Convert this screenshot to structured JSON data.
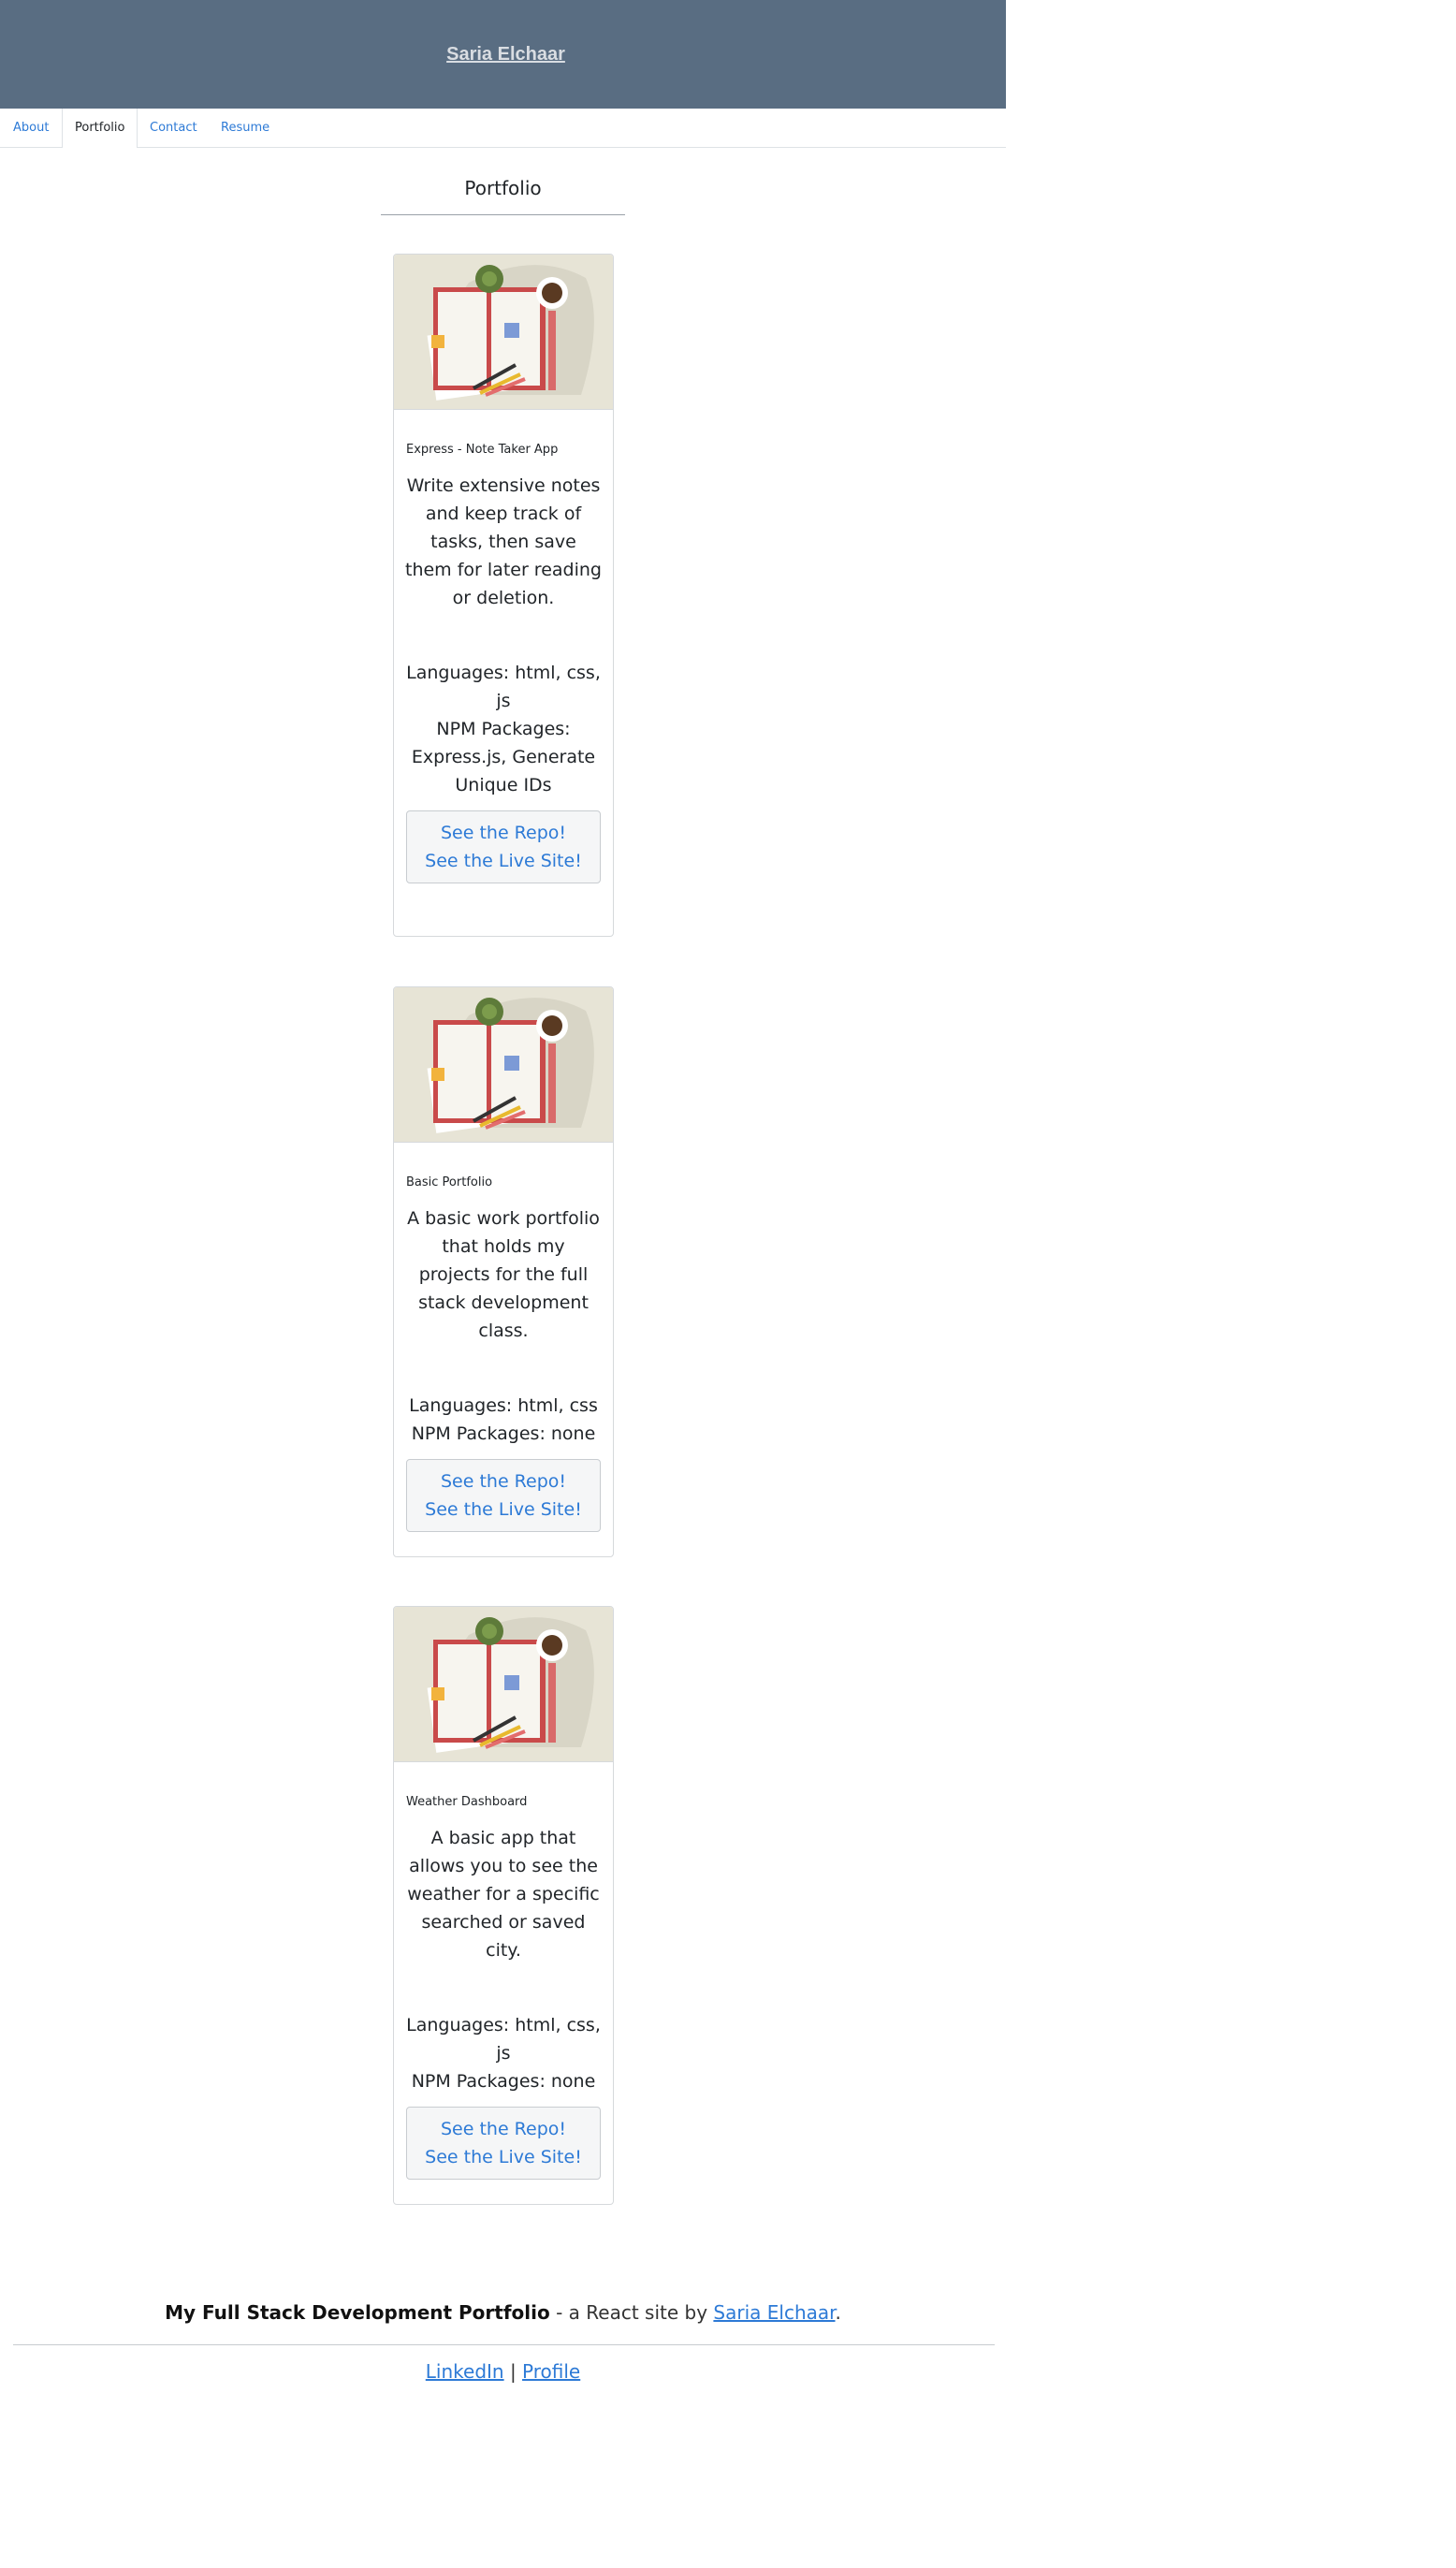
{
  "header": {
    "title": "Saria Elchaar"
  },
  "nav": {
    "items": [
      "About",
      "Portfolio",
      "Contact",
      "Resume"
    ]
  },
  "main": {
    "title": "Portfolio",
    "projects": [
      {
        "name": "Express - Note Taker App",
        "description": "Write extensive notes and keep track of tasks, then save them for later reading or deletion.",
        "languages": "Languages: html, css, js",
        "packages": "NPM Packages: Express.js, Generate Unique IDs",
        "repo_label": "See the Repo!",
        "live_label": "See the Live Site!"
      },
      {
        "name": "Basic Portfolio",
        "description": "A basic work portfolio that holds my projects for the full stack development class.",
        "languages": "Languages: html, css",
        "packages": "NPM Packages: none",
        "repo_label": "See the Repo!",
        "live_label": "See the Live Site!"
      },
      {
        "name": "Weather Dashboard",
        "description": "A basic app that allows you to see the weather for a specific searched or saved city.",
        "languages": "Languages: html, css, js",
        "packages": "NPM Packages: none",
        "repo_label": "See the Repo!",
        "live_label": "See the Live Site!"
      }
    ]
  },
  "footer": {
    "site_name": "My Full Stack Development Portfolio",
    "by_text": " - a React site by ",
    "author_link": "Saria Elchaar",
    "period": ".",
    "linkedin_label": "LinkedIn",
    "separator": " | ",
    "profile_label": "Profile"
  },
  "colors": {
    "header_bg": "#596d82",
    "link": "#2d7ad6",
    "card_image_bg": "#e7e4d6"
  }
}
